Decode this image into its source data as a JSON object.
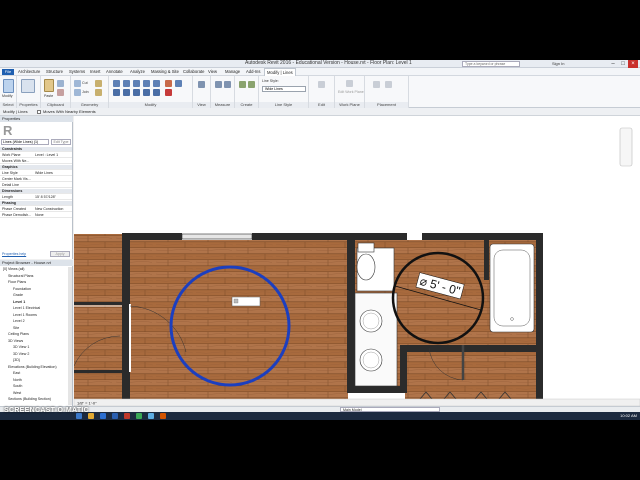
{
  "window": {
    "title": "Autodesk Revit 2016 - Educational Version -    House.rvt - Floor Plan: Level 1",
    "search_placeholder": "Type a keyword or phrase",
    "signin": "Sign In"
  },
  "menu": {
    "file": "File",
    "tabs": [
      "Architecture",
      "Structure",
      "Systems",
      "Insert",
      "Annotate",
      "Analyze",
      "Massing & Site",
      "Collaborate",
      "View",
      "Manage",
      "Add-Ins",
      "Modify | Lines"
    ]
  },
  "ribbon": {
    "groups": [
      "Select",
      "Properties",
      "Clipboard",
      "Geometry",
      "Modify",
      "View",
      "Measure",
      "Create",
      "Line Style",
      "Edit",
      "Work Plane",
      "Placement"
    ],
    "modify_label": "Modify",
    "line_style_label": "Line Style:",
    "line_style_value": "Wide Lines",
    "edit_sketch": "Edit Work Plane",
    "cut": "Cut",
    "join": "Join",
    "paste": "Paste"
  },
  "optbar": {
    "mode": "Modify | Lines",
    "moves_with": "Moves With Nearby Elements"
  },
  "properties": {
    "title": "Properties",
    "type": "Lines (Wide Lines) (1)",
    "edit_type": "Edit Type",
    "rows": [
      {
        "k": "Constraints",
        "v": "",
        "section": true
      },
      {
        "k": "Work Plane",
        "v": "Level : Level 1"
      },
      {
        "k": "Moves With Ne...",
        "v": ""
      },
      {
        "k": "Graphics",
        "v": "",
        "section": true
      },
      {
        "k": "Line Style",
        "v": "Wide Lines"
      },
      {
        "k": "Center Mark Vis...",
        "v": ""
      },
      {
        "k": "Detail Line",
        "v": ""
      },
      {
        "k": "Dimensions",
        "v": "",
        "section": true
      },
      {
        "k": "Length",
        "v": "15' 8 57/128\""
      },
      {
        "k": "Phasing",
        "v": "",
        "section": true
      },
      {
        "k": "Phase Created",
        "v": "New Construction"
      },
      {
        "k": "Phase Demolish...",
        "v": "None"
      }
    ],
    "help": "Properties help",
    "apply": "Apply"
  },
  "browser": {
    "title": "Project Browser - House.rvt",
    "items": [
      {
        "label": "[0] Views (all)",
        "indent": 0
      },
      {
        "label": "Structural Plans",
        "indent": 1
      },
      {
        "label": "Floor Plans",
        "indent": 1
      },
      {
        "label": "Foundation",
        "indent": 2
      },
      {
        "label": "Grade",
        "indent": 2
      },
      {
        "label": "Level 1",
        "indent": 2,
        "bold": true
      },
      {
        "label": "Level 1 Electrical",
        "indent": 2
      },
      {
        "label": "Level 1 Rooms",
        "indent": 2
      },
      {
        "label": "Level 2",
        "indent": 2
      },
      {
        "label": "Site",
        "indent": 2
      },
      {
        "label": "Ceiling Plans",
        "indent": 1
      },
      {
        "label": "3D Views",
        "indent": 1
      },
      {
        "label": "3D View 1",
        "indent": 2
      },
      {
        "label": "3D View 2",
        "indent": 2
      },
      {
        "label": "{3D}",
        "indent": 2
      },
      {
        "label": "Elevations (Building Elevation)",
        "indent": 1
      },
      {
        "label": "East",
        "indent": 2
      },
      {
        "label": "North",
        "indent": 2
      },
      {
        "label": "South",
        "indent": 2
      },
      {
        "label": "West",
        "indent": 2
      },
      {
        "label": "Sections (Building Section)",
        "indent": 1
      }
    ]
  },
  "canvas": {
    "dimension_label": "⌀ 5' - 0\"",
    "scale": "1/8\" = 1'-0\""
  },
  "status": {
    "text": "",
    "model": "Main Model"
  },
  "taskbar": {
    "watermark": "SCREENCAST-O-MATIC",
    "clock": "10:02 AM"
  },
  "colors": {
    "wood": "#a86a3d",
    "wall": "#2b2b2b",
    "circle_blue": "#1c3fbf",
    "accent": "#1f5fb0"
  }
}
